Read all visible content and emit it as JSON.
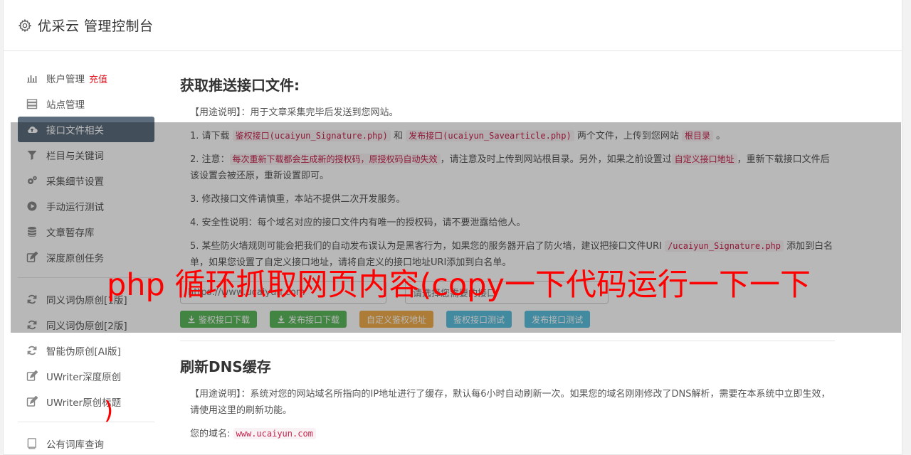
{
  "header": {
    "title": "优采云 管理控制台"
  },
  "sidebar": {
    "items": [
      {
        "label": "账户管理",
        "badge": "充值",
        "icon": "bar-chart-icon"
      },
      {
        "label": "站点管理",
        "icon": "server-icon"
      },
      {
        "label": "接口文件相关",
        "icon": "cloud-upload-icon",
        "active": true
      },
      {
        "label": "栏目与关键词",
        "icon": "filter-icon"
      },
      {
        "label": "采集细节设置",
        "icon": "gears-icon"
      },
      {
        "label": "手动运行测试",
        "icon": "play-circle-icon"
      },
      {
        "label": "文章暂存库",
        "icon": "database-icon"
      },
      {
        "label": "深度原创任务",
        "icon": "edit-icon"
      }
    ],
    "items2": [
      {
        "label": "同义词伪原创[1版]",
        "icon": "refresh-icon"
      },
      {
        "label": "同义词伪原创[2版]",
        "icon": "refresh-icon"
      },
      {
        "label": "智能伪原创[AI版]",
        "icon": "refresh-icon"
      },
      {
        "label": "UWriter深度原创",
        "icon": "edit-icon"
      },
      {
        "label": "UWriter原创标题",
        "icon": "edit-icon"
      }
    ],
    "items3": [
      {
        "label": "公有词库查询",
        "icon": "book-icon"
      }
    ]
  },
  "main": {
    "section1": {
      "title": "获取推送接口文件:",
      "usage_label": "【用途说明】",
      "usage_text": "：用于文章采集完毕后发送到您网站。",
      "step1": {
        "pre": "1. 请下载 ",
        "code1": "鉴权接口(ucaiyun_Signature.php)",
        "mid1": " 和 ",
        "code2": "发布接口(ucaiyun_Savearticle.php)",
        "mid2": " 两个文件，上传到您网站 ",
        "code3": "根目录",
        "post": " 。"
      },
      "step2": {
        "pre": "2. 注意：",
        "code1": "每次重新下载都会生成新的授权码，原授权码自动失效",
        "mid": "，请注意及时上传到网站根目录。另外，如果之前设置过",
        "code2": "自定义接口地址",
        "post": "，重新下载接口文件后该设置会被还原，重新设置即可。"
      },
      "step3": "3. 修改接口文件请慎重，本站不提供二次开发服务。",
      "step4": "4. 安全性说明：每个域名对应的接口文件内有唯一的授权码，请不要泄露给他人。",
      "step5": {
        "pre": "5. 某些防火墙规则可能会把我们的自动发布误认为是黑客行为，如果您的服务器开启了防火墙，建议把接口文件URI ",
        "code1": "/ucaiyun_Signature.php",
        "post": " 添加到白名单，如果您设置了自定义接口地址，请将自定义的接口地址URI添加到白名单。"
      },
      "url_input": "https://www.ucaiyun.com",
      "select_placeholder": "请选择您需要的接口",
      "buttons": {
        "auth_download": "鉴权接口下载",
        "publish_download": "发布接口下载",
        "custom_auth": "自定义鉴权地址",
        "auth_test": "鉴权接口测试",
        "publish_test": "发布接口测试"
      }
    },
    "section2": {
      "title": "刷新DNS缓存",
      "usage_label": "【用途说明】",
      "usage_text": "：系统对您的网站域名所指向的IP地址进行了缓存，默认每6小时自动刷新一次。如果您的域名刚刚修改了DNS解析，需要在本系统中立即生效，请使用这里的刷新功能。",
      "domain_label": "您的域名:",
      "domain_value": "www.ucaiyun.com"
    }
  },
  "watermark": {
    "text": "php 循环抓取网页内容(copy一下代码运行一下一下",
    "paren": ")"
  },
  "colors": {
    "active_nav": "#5d6d7e",
    "green": "#5cb85c",
    "orange": "#f0ad4e",
    "blue": "#5bc0de",
    "code": "#c7254e",
    "watermark": "#ff0000",
    "badge": "#e41b23"
  }
}
